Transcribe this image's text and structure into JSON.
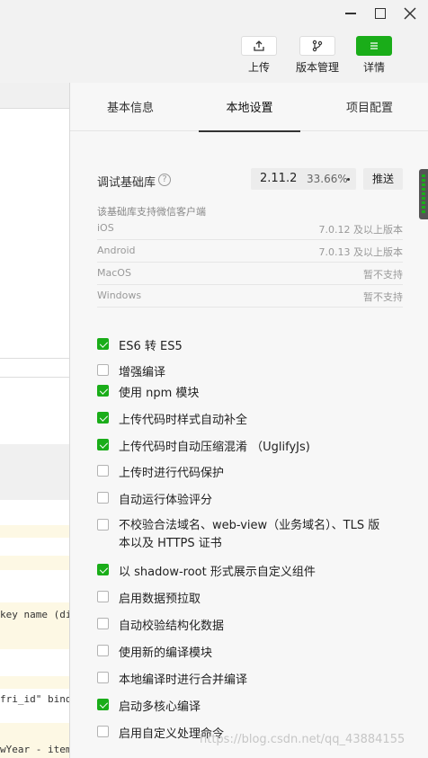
{
  "toolbar": {
    "upload": "上传",
    "version": "版本管理",
    "details": "详情"
  },
  "editor": {
    "code_lines": [
      "key name (di",
      "fri_id\" bind",
      "wYear - item"
    ]
  },
  "tabs": [
    "基本信息",
    "本地设置",
    "项目配置"
  ],
  "library": {
    "label": "调试基础库",
    "help": "?",
    "version": "2.11.2",
    "percent": "33.66%",
    "push": "推送"
  },
  "support_note": "该基础库支持微信客户端",
  "os_support": [
    {
      "name": "iOS",
      "value": "7.0.12 及以上版本"
    },
    {
      "name": "Android",
      "value": "7.0.13 及以上版本"
    },
    {
      "name": "MacOS",
      "value": "暂不支持"
    },
    {
      "name": "Windows",
      "value": "暂不支持"
    }
  ],
  "options": [
    {
      "label": "ES6 转 ES5",
      "checked": true
    },
    {
      "label": "增强编译",
      "checked": false
    },
    {
      "label": "使用 npm 模块",
      "checked": true
    },
    {
      "label": "上传代码时样式自动补全",
      "checked": true
    },
    {
      "label": "上传代码时自动压缩混淆 （UglifyJs)",
      "checked": true
    },
    {
      "label": "上传时进行代码保护",
      "checked": false
    },
    {
      "label": "自动运行体验评分",
      "checked": false
    },
    {
      "label": "不校验合法域名、web-view（业务域名）、TLS 版本以及 HTTPS 证书",
      "checked": false
    },
    {
      "label": "以 shadow-root 形式展示自定义组件",
      "checked": true
    },
    {
      "label": "启用数据预拉取",
      "checked": false
    },
    {
      "label": "自动校验结构化数据",
      "checked": false
    },
    {
      "label": "使用新的编译模块",
      "checked": false
    },
    {
      "label": "本地编译时进行合并编译",
      "checked": false
    },
    {
      "label": "启动多核心编译",
      "checked": true
    },
    {
      "label": "启用自定义处理命令",
      "checked": false
    }
  ],
  "watermark": "https://blog.csdn.net/qq_43884155",
  "colors": {
    "accent": "#1aad19"
  }
}
